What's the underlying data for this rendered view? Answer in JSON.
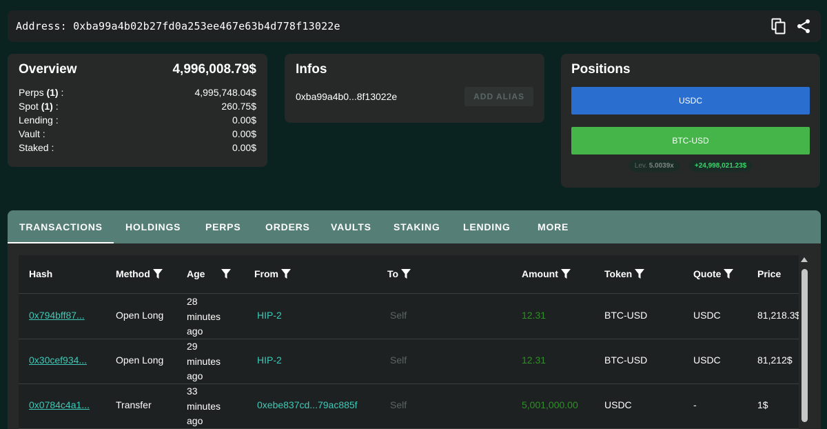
{
  "address_bar": {
    "text": "Address: 0xba99a4b02b27fd0a253ee467e63b4d778f13022e"
  },
  "overview": {
    "title": "Overview",
    "total": "4,996,008.79$",
    "rows": [
      {
        "label_pre": "Perps ",
        "count": "(1)",
        "label_post": " :",
        "value": "4,995,748.04$"
      },
      {
        "label_pre": "Spot ",
        "count": "(1)",
        "label_post": " :",
        "value": "260.75$"
      },
      {
        "label_pre": "Lending :",
        "count": "",
        "label_post": "",
        "value": "0.00$"
      },
      {
        "label_pre": "Vault :",
        "count": "",
        "label_post": "",
        "value": "0.00$"
      },
      {
        "label_pre": "Staked :",
        "count": "",
        "label_post": "",
        "value": "0.00$"
      }
    ]
  },
  "infos": {
    "title": "Infos",
    "short_address": "0xba99a4b0...8f13022e",
    "alias_button": "ADD ALIAS"
  },
  "positions": {
    "title": "Positions",
    "usdc_label": "USDC",
    "btc_label": "BTC-USD",
    "lev_label": "Lev.",
    "lev_value": "5.0039x",
    "pnl": "+24,998,021.23$"
  },
  "tabs": [
    "TRANSACTIONS",
    "HOLDINGS",
    "PERPS",
    "ORDERS",
    "VAULTS",
    "STAKING",
    "LENDING",
    "MORE"
  ],
  "table": {
    "headers": [
      "Hash",
      "Method",
      "Age",
      "From",
      "To",
      "Amount",
      "Token",
      "Quote",
      "Price"
    ],
    "rows": [
      {
        "hash": "0x794bff87...",
        "method": "Open Long",
        "age": [
          "28",
          "minutes",
          "ago"
        ],
        "from": "HIP-2",
        "to": "Self",
        "amount": "12.31",
        "token": "BTC-USD",
        "quote": "USDC",
        "price": "81,218.3$"
      },
      {
        "hash": "0x30cef934...",
        "method": "Open Long",
        "age": [
          "29",
          "minutes",
          "ago"
        ],
        "from": "HIP-2",
        "to": "Self",
        "amount": "12.31",
        "token": "BTC-USD",
        "quote": "USDC",
        "price": "81,212$"
      },
      {
        "hash": "0x0784c4a1...",
        "method": "Transfer",
        "age": [
          "33",
          "minutes",
          "ago"
        ],
        "from": "0xebe837cd...79ac885f",
        "to": "Self",
        "amount": "5,001,000.00",
        "token": "USDC",
        "quote": "-",
        "price": "1$"
      }
    ]
  },
  "colors": {
    "background": "#0b2320",
    "card": "#262928",
    "tab_bar": "#557e77",
    "link": "#3fc9b8",
    "usdc": "#2a6fd0",
    "btc": "#45b549",
    "amount": "#2f8f28"
  }
}
